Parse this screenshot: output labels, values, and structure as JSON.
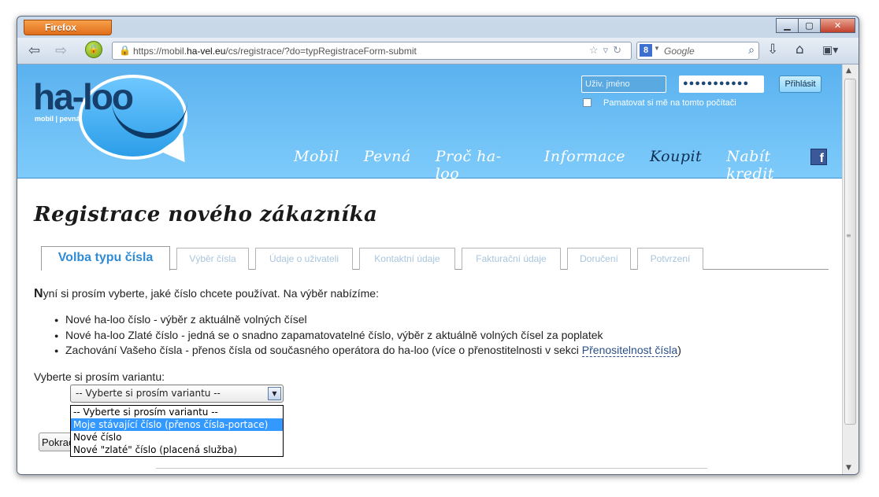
{
  "browser": {
    "app_button": "Firefox",
    "url_prefix": "https://mobil.",
    "url_host": "ha-vel.eu",
    "url_path": "/cs/registrace/?do=typRegistraceForm-submit",
    "search_engine_icon": "8",
    "search_placeholder": "Google"
  },
  "site": {
    "logo_text": "ha-loo",
    "logo_sub": "mobil | pevná",
    "login": {
      "username_placeholder": "Uživ. jméno",
      "password_value": "●●●●●●●●●●●",
      "submit_label": "Přihlásit",
      "remember_label": "Pamatovat si mě na tomto počítači"
    },
    "nav": [
      {
        "label": "Mobil"
      },
      {
        "label": "Pevná"
      },
      {
        "label": "Proč ha-loo"
      },
      {
        "label": "Informace"
      },
      {
        "label": "Koupit"
      },
      {
        "label": "Nabít kredit"
      }
    ],
    "facebook_icon_label": "f"
  },
  "page": {
    "title": "Registrace nového zákazníka",
    "tabs": [
      {
        "label": "Volba typu čísla"
      },
      {
        "label": "Výběr čísla"
      },
      {
        "label": "Údaje o uživateli"
      },
      {
        "label": "Kontaktní údaje"
      },
      {
        "label": "Fakturační údaje"
      },
      {
        "label": "Doručení"
      },
      {
        "label": "Potvrzení"
      }
    ],
    "intro_first_letter": "N",
    "intro_rest": "yní si prosím vyberte, jaké číslo chcete používat. Na výběr nabízíme:",
    "bullets": [
      "Nové ha-loo číslo - výběr z aktuálně volných čísel",
      "Nové ha-loo Zlaté číslo - jedná se o snadno zapamatovatelné číslo, výběr z aktuálně volných čísel za poplatek"
    ],
    "bullet3_text": "Zachování Vašeho čísla - přenos čísla od současného operátora do ha-loo (více o přenostitelnosti v sekci ",
    "bullet3_link": "Přenositelnost čísla",
    "bullet3_end": ")",
    "variant_label": "Vyberte si prosím variantu:",
    "select_value": "-- Vyberte si prosím variantu --",
    "select_options": [
      "-- Vyberte si prosím variantu --",
      "Moje stávající číslo (přenos čísla-portace)",
      "Nové číslo",
      "Nové \"zlaté\" číslo (placená služba)"
    ],
    "highlighted_option": 1,
    "continue_label": "Pokračovat"
  }
}
